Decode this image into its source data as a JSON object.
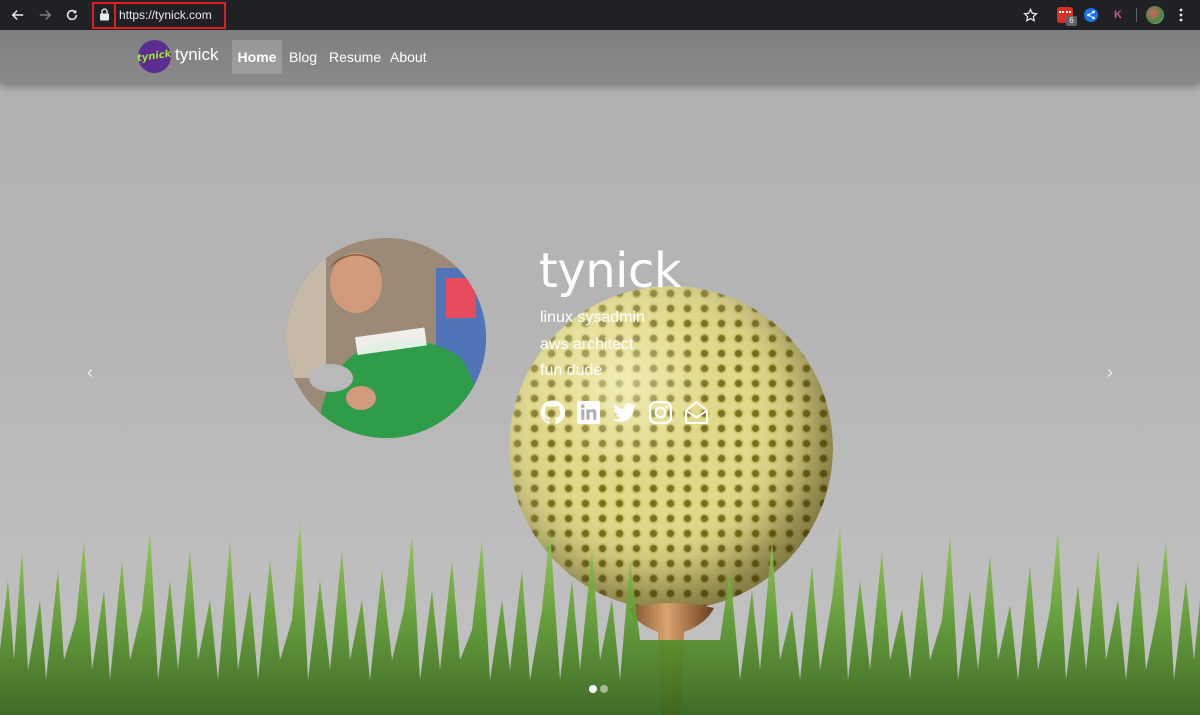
{
  "browser": {
    "url": "https://tynick.com",
    "extension_badge": "6",
    "extension_k_label": "K",
    "icons": [
      "back-arrow-icon",
      "forward-arrow-icon",
      "reload-icon",
      "lock-icon",
      "star-icon",
      "extension-icon",
      "share-icon",
      "profile-icon",
      "menu-icon"
    ]
  },
  "navbar": {
    "brand_logo_text": "tynick",
    "brand_name": "tynick",
    "items": [
      {
        "label": "Home",
        "active": true
      },
      {
        "label": "Blog",
        "active": false
      },
      {
        "label": "Resume",
        "active": false
      },
      {
        "label": "About",
        "active": false
      }
    ]
  },
  "hero": {
    "title": "tynick",
    "lines": [
      "linux sysadmin",
      "aws architect",
      "fun dude"
    ],
    "socials": [
      "github-icon",
      "linkedin-icon",
      "twitter-icon",
      "instagram-icon",
      "email-icon"
    ]
  },
  "carousel": {
    "prev_glyph": "‹",
    "next_glyph": "›",
    "slide_count": 2,
    "active_slide": 1
  },
  "colors": {
    "accent_brand": "#5c2d91",
    "brand_text": "#9be52f",
    "highlight_box": "#e0201f"
  }
}
